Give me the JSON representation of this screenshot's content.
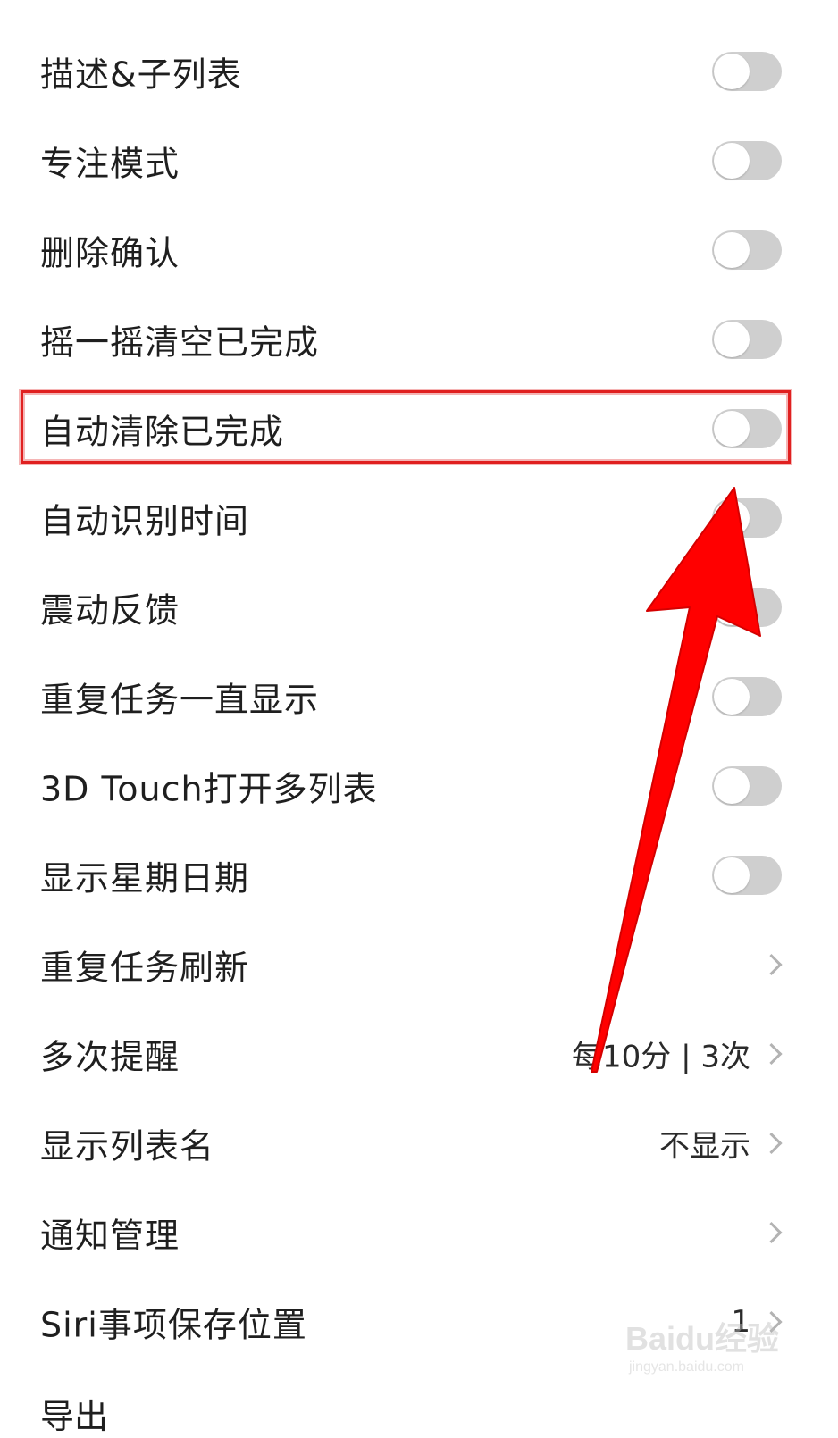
{
  "settings": [
    {
      "label": "描述&子列表",
      "control": "toggle",
      "on": false
    },
    {
      "label": "专注模式",
      "control": "toggle",
      "on": false
    },
    {
      "label": "删除确认",
      "control": "toggle",
      "on": false
    },
    {
      "label": "摇一摇清空已完成",
      "control": "toggle",
      "on": false
    },
    {
      "label": "自动清除已完成",
      "control": "toggle",
      "on": false,
      "highlighted": true
    },
    {
      "label": "自动识别时间",
      "control": "toggle",
      "on": false
    },
    {
      "label": "震动反馈",
      "control": "toggle",
      "on": false
    },
    {
      "label": "重复任务一直显示",
      "control": "toggle",
      "on": false
    },
    {
      "label": "3D Touch打开多列表",
      "control": "toggle",
      "on": false
    },
    {
      "label": "显示星期日期",
      "control": "toggle",
      "on": false
    },
    {
      "label": "重复任务刷新",
      "control": "chevron",
      "value": ""
    },
    {
      "label": "多次提醒",
      "control": "chevron",
      "value": "每10分 | 3次"
    },
    {
      "label": "显示列表名",
      "control": "chevron",
      "value": "不显示"
    },
    {
      "label": "通知管理",
      "control": "chevron",
      "value": ""
    },
    {
      "label": "Siri事项保存位置",
      "control": "chevron",
      "value": "1"
    }
  ],
  "partial_row_label": "导出",
  "annotation": {
    "highlight_color": "#e02020",
    "arrow_color": "#ff0000"
  },
  "watermark": {
    "main": "Baidu经验",
    "sub": "jingyan.baidu.com"
  }
}
